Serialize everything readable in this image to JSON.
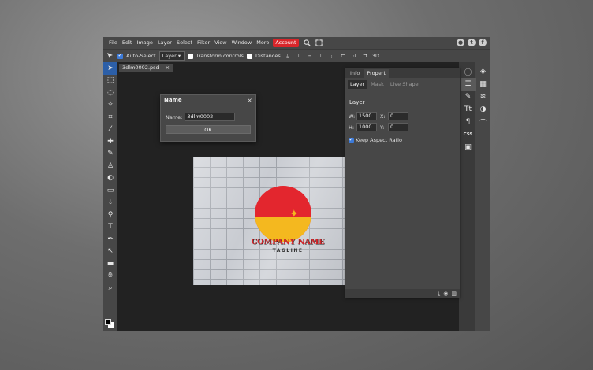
{
  "menu": {
    "items": [
      "File",
      "Edit",
      "Image",
      "Layer",
      "Select",
      "Filter",
      "View",
      "Window",
      "More"
    ],
    "account": "Account",
    "icons": [
      "search-icon",
      "fullscreen-icon"
    ],
    "social": [
      "reddit-icon",
      "twitter-icon",
      "facebook-icon"
    ]
  },
  "options": {
    "auto_select_label": "Auto-Select",
    "auto_select_checked": true,
    "layer_select": "Layer",
    "transform_label": "Transform controls",
    "distances_label": "Distances",
    "threed_label": "3D"
  },
  "tools": [
    "move-tool-icon",
    "marquee-tool-icon",
    "lasso-tool-icon",
    "magic-wand-icon",
    "crop-tool-icon",
    "eyedropper-icon",
    "healing-brush-icon",
    "brush-tool-icon",
    "clone-stamp-icon",
    "eraser-icon",
    "gradient-tool-icon",
    "blur-tool-icon",
    "dodge-tool-icon",
    "type-tool-icon",
    "pen-tool-icon",
    "path-select-icon",
    "shape-tool-icon",
    "hand-tool-icon",
    "zoom-tool-icon"
  ],
  "document": {
    "tab_name": "3dlm0002.psd",
    "close": "×"
  },
  "canvas": {
    "company": "COMPANY NAME",
    "tagline": "TAGLINE"
  },
  "dialog": {
    "title": "Name",
    "close": "×",
    "field_label": "Name:",
    "field_value": "3dlm0002",
    "ok_label": "OK"
  },
  "panel": {
    "tabs": [
      "Info",
      "Propert"
    ],
    "subtabs": [
      "Layer",
      "Mask",
      "Live Shape"
    ],
    "section": "Layer",
    "w_label": "W:",
    "w_value": "1500",
    "x_label": "X:",
    "x_value": "0",
    "h_label": "H:",
    "h_value": "1000",
    "y_label": "Y:",
    "y_value": "0",
    "keep_ratio_label": "Keep Aspect Ratio",
    "keep_ratio_checked": true
  },
  "right_icons": {
    "col1": [
      "history-icon",
      "adjust-icon",
      "brush-preset-icon",
      "character-icon",
      "paragraph-icon",
      "css-icon",
      "image-icon"
    ],
    "col2": [
      "info-icon",
      "layers-stack-icon",
      "swatches-icon",
      "layers-icon",
      "channels-icon",
      "paths-icon"
    ],
    "css_label": "CSS"
  }
}
